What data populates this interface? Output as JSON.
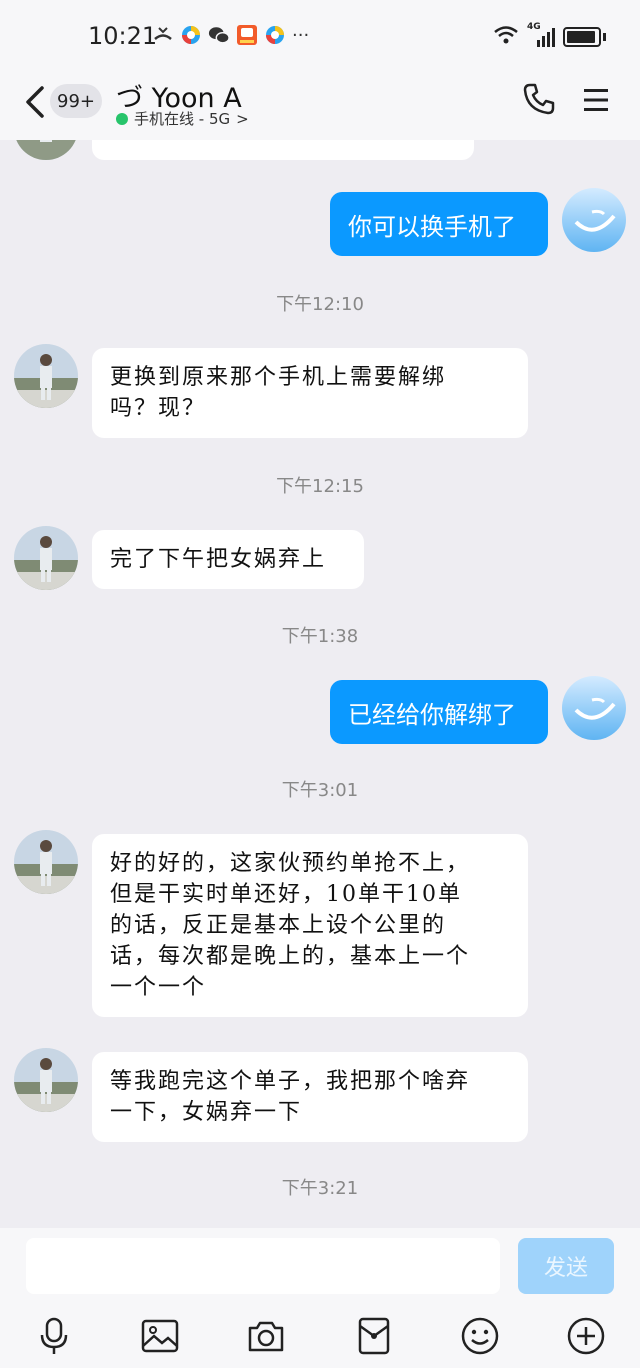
{
  "status_bar": {
    "time": "10:21",
    "dots": "···",
    "network_label": "4G",
    "notification_icons": [
      "missed-call-icon",
      "qq-browser-icon",
      "wechat-icon",
      "app-badge-icon",
      "qq-browser-icon"
    ]
  },
  "header": {
    "unread_count": "99+",
    "contact_name": "づ Yoon A",
    "status_text": "手机在线 - 5G",
    "status_chevron": ">"
  },
  "messages": [
    {
      "type": "out",
      "text": "你可以换手机了"
    },
    {
      "type": "time",
      "text": "下午12:10"
    },
    {
      "type": "in",
      "lines": [
        "更换到原来那个手机上需要解绑",
        "吗？现？"
      ]
    },
    {
      "type": "time",
      "text": "下午12:15"
    },
    {
      "type": "in",
      "lines": [
        "完了下午把女娲弃上"
      ]
    },
    {
      "type": "time",
      "text": "下午1:38"
    },
    {
      "type": "out",
      "text": "已经给你解绑了"
    },
    {
      "type": "time",
      "text": "下午3:01"
    },
    {
      "type": "in",
      "lines": [
        "好的好的，这家伙预约单抢不上，",
        "但是干实时单还好，10单干10单",
        "的话，反正是基本上设个公里的",
        "话，每次都是晚上的，基本上一个",
        "一个一个"
      ]
    },
    {
      "type": "in",
      "lines": [
        "等我跑完这个单子，我把那个啥弃",
        "一下，女娲弃一下"
      ]
    },
    {
      "type": "time",
      "text": "下午3:21"
    }
  ],
  "input": {
    "value": "",
    "send_label": "发送"
  },
  "toolbar": [
    "microphone-icon",
    "image-icon",
    "camera-icon",
    "red-packet-icon",
    "emoji-icon",
    "plus-icon"
  ],
  "colors": {
    "accent": "#0b99ff",
    "send_disabled": "#9fd3fb",
    "online": "#27c46b",
    "background": "#eeedf2"
  }
}
